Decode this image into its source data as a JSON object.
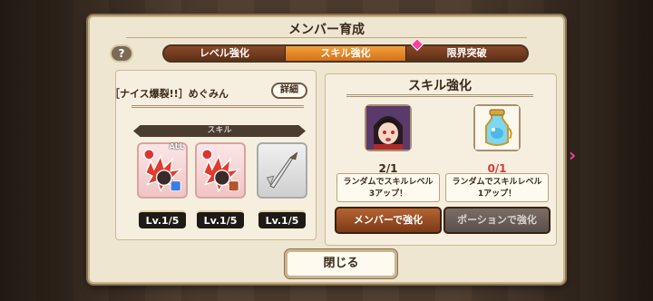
{
  "window": {
    "title": "メンバー育成"
  },
  "help": {
    "label": "?"
  },
  "tabs": [
    {
      "label": "レベル強化",
      "active": false
    },
    {
      "label": "スキル強化",
      "active": true
    },
    {
      "label": "限界突破",
      "active": false
    }
  ],
  "member": {
    "name": "［ナイス爆裂!!］めぐみん",
    "detail_label": "詳細"
  },
  "skills": {
    "header": "スキル",
    "items": [
      {
        "level": "Lv.1/5",
        "badge": "ALL",
        "icon": "bomb-explosion-icon"
      },
      {
        "level": "Lv.1/5",
        "icon": "bomb-explosion-icon"
      },
      {
        "level": "Lv.1/5",
        "icon": "dagger-icon"
      }
    ]
  },
  "skill_up": {
    "title": "スキル強化",
    "member_option": {
      "count": "2/1",
      "description_line1": "ランダムでスキルレベル",
      "description_line2": "3アップ！",
      "button_label": "メンバーで強化",
      "icon": "member-portrait-icon"
    },
    "potion_option": {
      "count": "0/1",
      "description_line1": "ランダムでスキルレベル",
      "description_line2": "1アップ！",
      "button_label": "ポーションで強化",
      "icon": "potion-icon"
    }
  },
  "close_label": "閉じる",
  "arrows": {
    "left": "‹",
    "right": "›"
  },
  "colors": {
    "accent_tab": "#f3a03a",
    "pink": "#ff3fa0",
    "zero_count": "#d93b3b"
  }
}
